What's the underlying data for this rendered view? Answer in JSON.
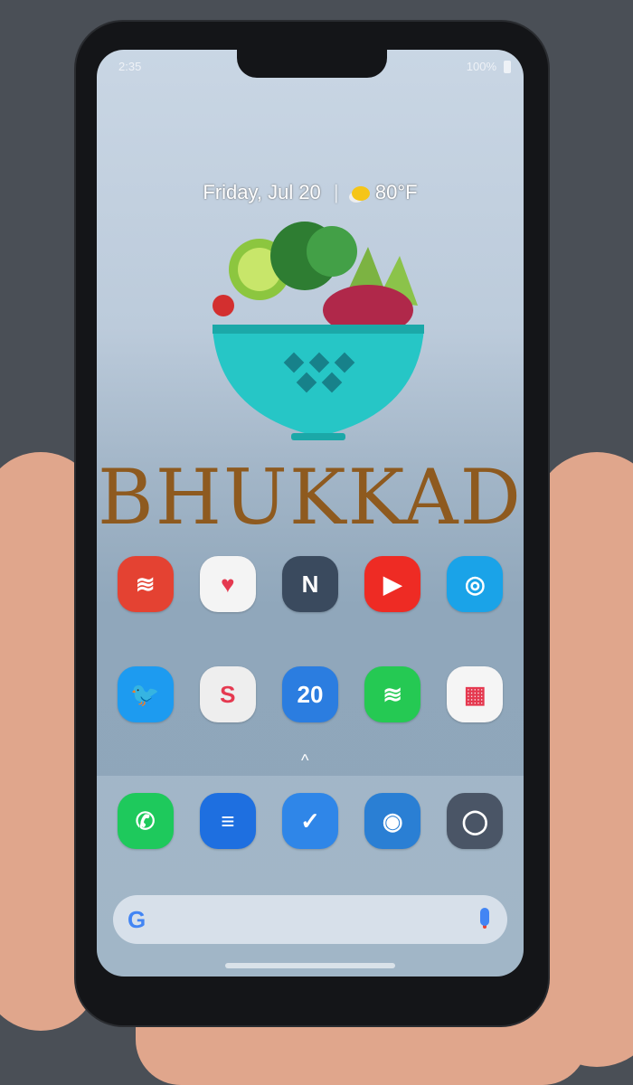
{
  "status_bar": {
    "time": "2:35",
    "battery": "100%"
  },
  "widget": {
    "date": "Friday, Jul 20",
    "separator": "|",
    "temperature": "80°F",
    "weather_icon": "partly-cloudy-icon"
  },
  "logo": {
    "text": "BHUKKAD"
  },
  "apps_row1": [
    {
      "name": "todoist",
      "color": "#e44232",
      "glyph": "≋"
    },
    {
      "name": "pocket",
      "color": "#f4f4f4",
      "glyph": "♥"
    },
    {
      "name": "pushbullet",
      "color": "#3a4a5e",
      "glyph": "N"
    },
    {
      "name": "youtube",
      "color": "#ee2b24",
      "glyph": "▶"
    },
    {
      "name": "find-device",
      "color": "#1aa3e8",
      "glyph": "◎"
    }
  ],
  "apps_row2": [
    {
      "name": "twitter",
      "color": "#1d9bf0",
      "glyph": "🐦"
    },
    {
      "name": "slack",
      "color": "#eeeeee",
      "glyph": "S"
    },
    {
      "name": "calendar",
      "color": "#2b7de0",
      "glyph": "20"
    },
    {
      "name": "spotify",
      "color": "#25c953",
      "glyph": "≋"
    },
    {
      "name": "play-games",
      "color": "#f5f5f5",
      "glyph": "▦"
    }
  ],
  "dock": [
    {
      "name": "phone",
      "color": "#1ec95c",
      "glyph": "✆"
    },
    {
      "name": "messages",
      "color": "#1e6fe0",
      "glyph": "≡"
    },
    {
      "name": "inbox",
      "color": "#2f86e8",
      "glyph": "✓"
    },
    {
      "name": "firefox",
      "color": "#2a7fd4",
      "glyph": "◉"
    },
    {
      "name": "camera",
      "color": "#4a5566",
      "glyph": "◯"
    }
  ],
  "search": {
    "logo": "G",
    "mic_icon": "mic-icon"
  },
  "drawer_chevron": "^"
}
